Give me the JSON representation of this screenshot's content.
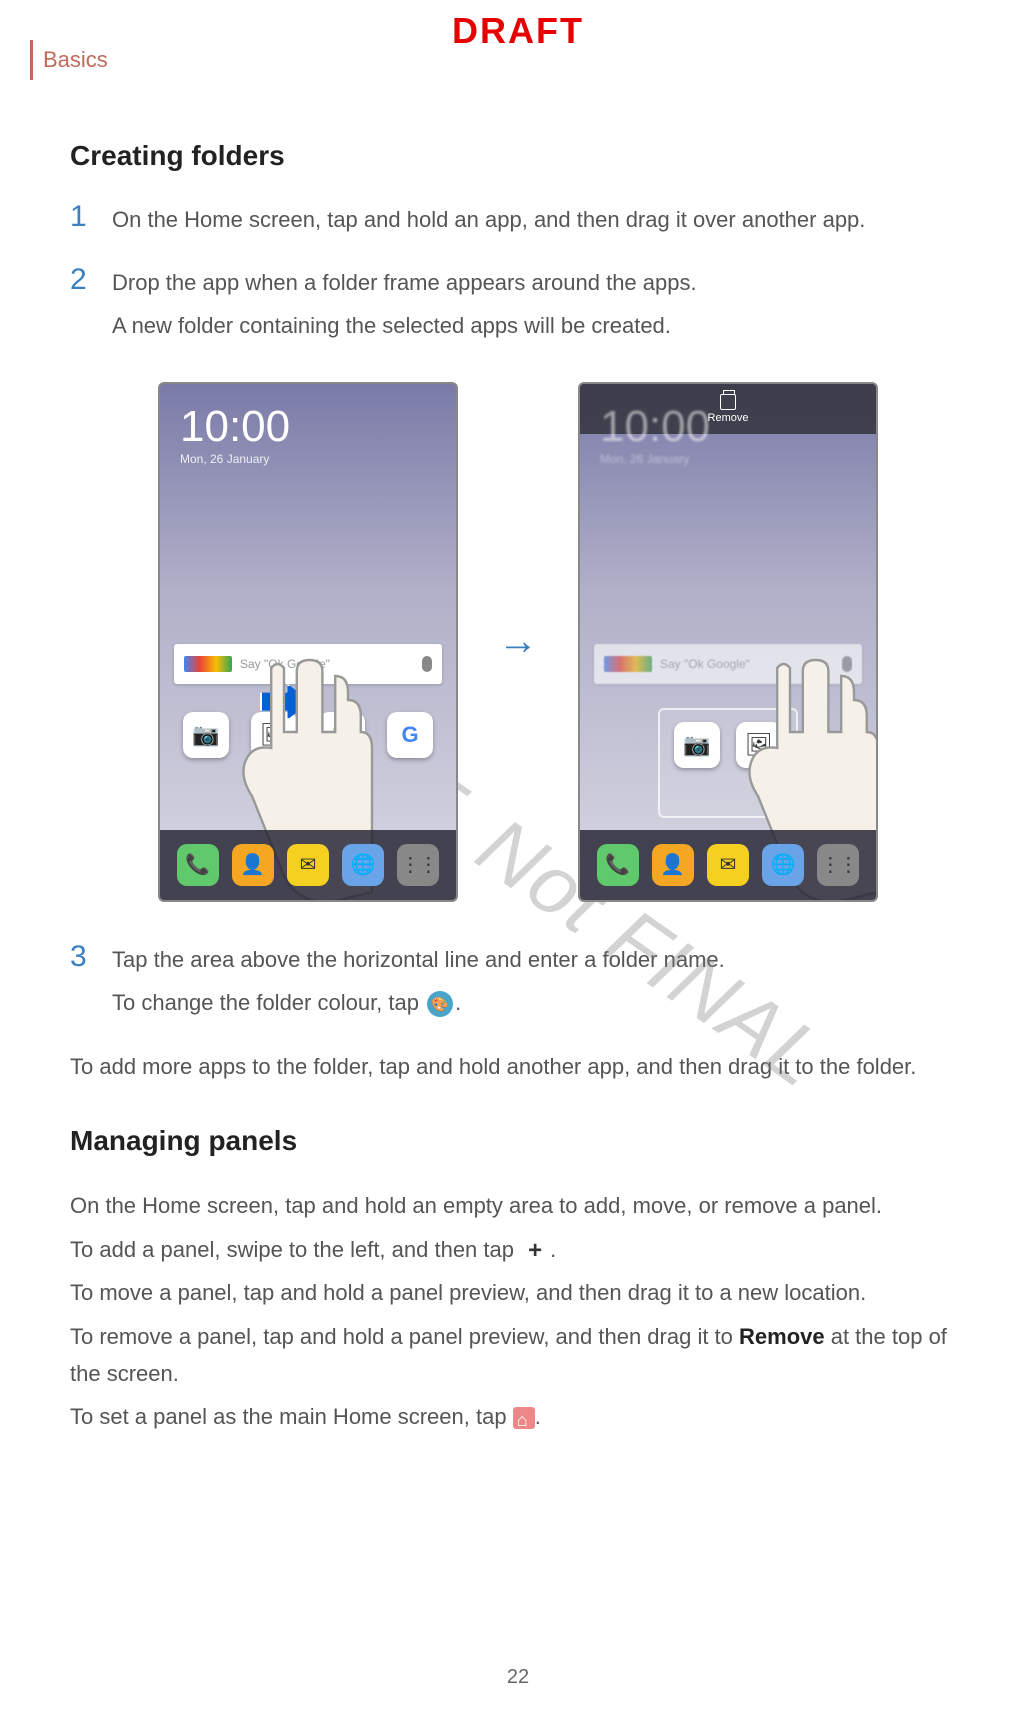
{
  "header": {
    "section": "Basics",
    "draft_label": "DRAFT"
  },
  "watermark": "DRAFT, Not FINAL",
  "section1": {
    "title": "Creating folders",
    "steps": [
      {
        "num": "1",
        "text": "On the Home screen, tap and hold an app, and then drag it over another app."
      },
      {
        "num": "2",
        "text": "Drop the app when a folder frame appears around the apps.",
        "subtext": "A new folder containing the selected apps will be created."
      },
      {
        "num": "3",
        "text": "Tap the area above the horizontal line and enter a folder name.",
        "subtext_prefix": "To change the folder colour, tap ",
        "subtext_suffix": "."
      }
    ],
    "footer": "To add more apps to the folder, tap and hold another app, and then drag it to the folder."
  },
  "section2": {
    "title": "Managing panels",
    "p1": "On the Home screen, tap and hold an empty area to add, move, or remove a panel.",
    "p2_prefix": "To add a panel, swipe to the left, and then tap ",
    "p2_suffix": ".",
    "p3": "To move a panel, tap and hold a panel preview, and then drag it to a new location.",
    "p4_prefix": "To remove a panel, tap and hold a panel preview, and then drag it to ",
    "p4_bold": "Remove",
    "p4_suffix": " at the top of the screen.",
    "p5_prefix": "To set a panel as the main Home screen, tap ",
    "p5_suffix": "."
  },
  "phone": {
    "clock": "10:00",
    "date": "Mon, 26 January",
    "search_hint": "Say \"Ok Google\"",
    "remove_label": "Remove"
  },
  "page_number": "22"
}
